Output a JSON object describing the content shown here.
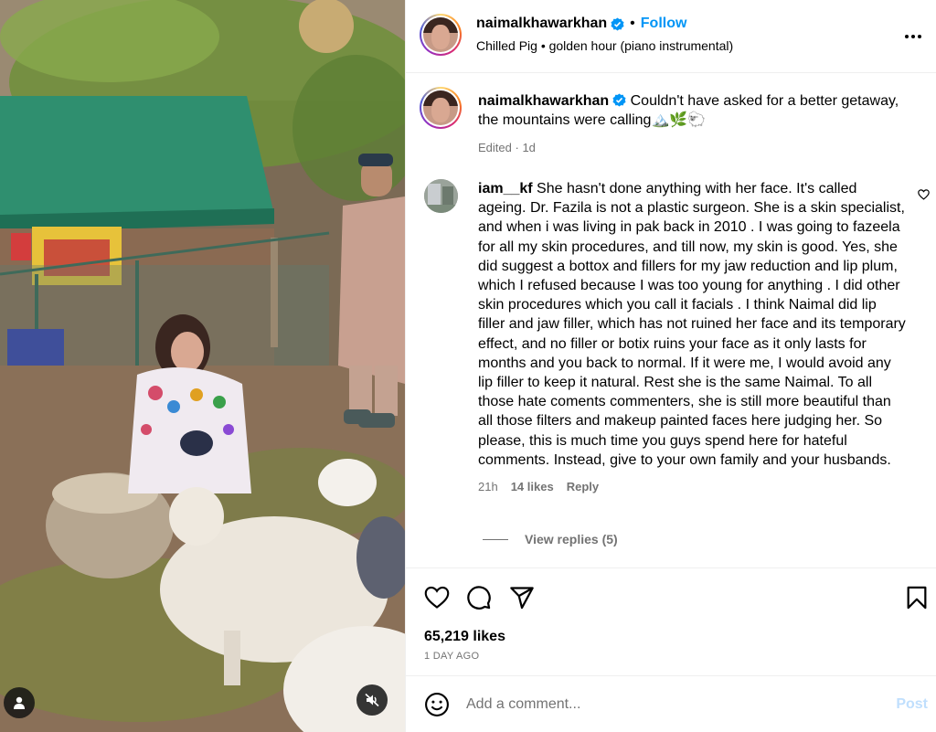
{
  "post": {
    "username": "naimalkhawarkhan",
    "verified_icon": "verified-badge-icon",
    "separator": "•",
    "follow_label": "Follow",
    "audio": "Chilled Pig • golden hour (piano instrumental)",
    "more_icon": "more-options-icon"
  },
  "caption": {
    "username": "naimalkhawarkhan",
    "text": "Couldn't have asked for a better getaway, the mountains were calling🏔️🌿🐑",
    "edited": "Edited",
    "time": "1d"
  },
  "comment": {
    "username": "iam__kf",
    "text": "She hasn't done anything with her face. It's called ageing. Dr. Fazila is not a plastic surgeon. She is a skin specialist, and when i was living in pak back in 2010 . I was going to fazeela for all my skin procedures, and till now, my skin is good. Yes, she did suggest a bottox and fillers for my jaw reduction and lip plum, which I refused because I was too young for anything . I did other skin procedures which you call it facials . I think Naimal did lip filler and jaw filler, which has not ruined her face and its temporary effect, and no filler or botix ruins your face as it only lasts for months and you back to normal. If it were me, I would avoid any lip filler to keep it natural. Rest she is the same Naimal. To all those hate coments commenters, she is still more beautiful than all those filters and makeup painted faces here judging her. So please, this is much time you guys spend here for hateful comments. Instead, give to your own family and your husbands.",
    "time": "21h",
    "likes": "14 likes",
    "reply_label": "Reply",
    "view_replies": "View replies (5)"
  },
  "actions": {
    "likes": "65,219 likes",
    "date": "1 DAY AGO"
  },
  "add_comment": {
    "placeholder": "Add a comment...",
    "post_label": "Post"
  },
  "colors": {
    "link_blue": "#0095f6",
    "muted_gray": "#737373",
    "disabled_blue": "#c0dffd",
    "border": "#efefef"
  }
}
